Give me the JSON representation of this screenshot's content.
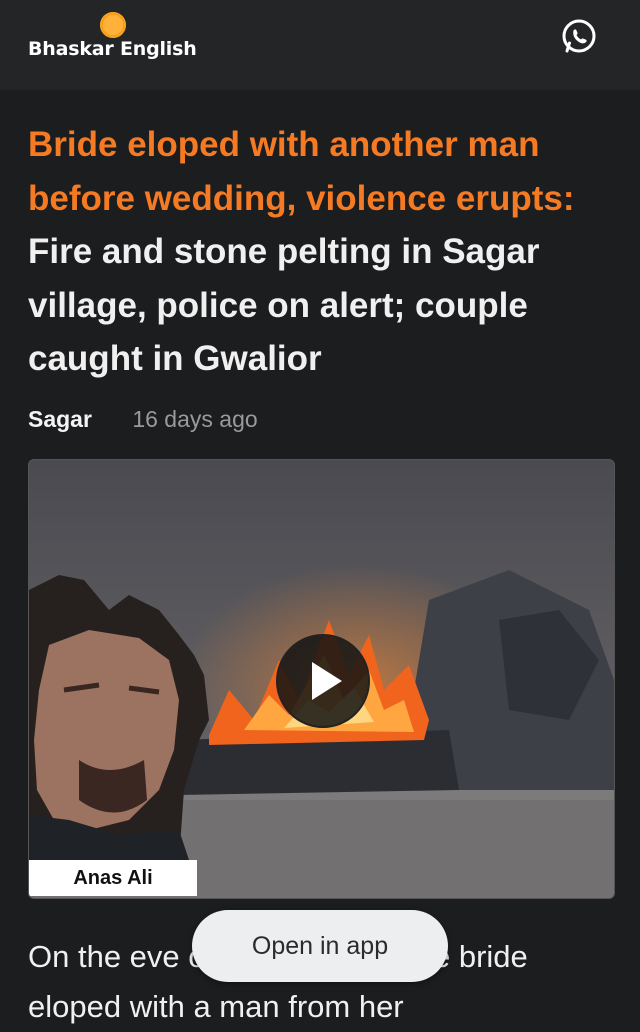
{
  "header": {
    "logo_text": "Bhaskar English",
    "whatsapp_icon": "whatsapp-icon",
    "brand_color": "#f59a16"
  },
  "article": {
    "headline_accent": "Bride eloped with another man before wedding, violence erupts:",
    "headline_rest": "Fire and stone pelting in Sagar village, police on alert; couple caught in Gwalior",
    "location": "Sagar",
    "time": "16 days ago",
    "media": {
      "caption": "Anas Ali",
      "play_icon": "play-icon"
    },
    "body_text": "On the eve of the wedding, the bride eloped with a man from her"
  },
  "open_app": {
    "label": "Open in app"
  },
  "colors": {
    "accent": "#f57a24",
    "background": "#1c1d1f",
    "topbar": "#242527"
  }
}
